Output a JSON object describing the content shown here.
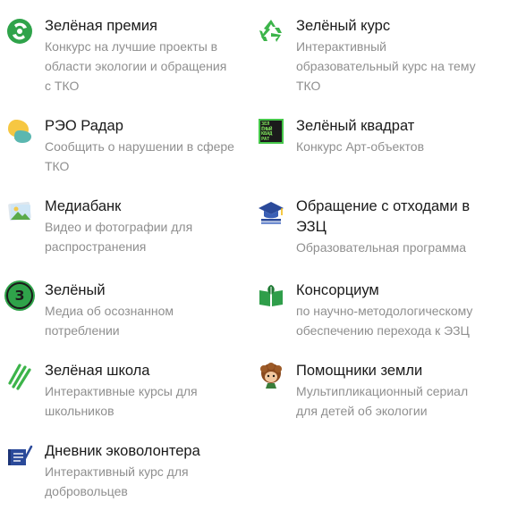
{
  "items": [
    {
      "title": "Зелёная премия",
      "desc": [
        "Конкурс на лучшие проекты в",
        "области экологии и обращения",
        "с ТКО"
      ],
      "icon": "green-award-icon"
    },
    {
      "title": "Зелёный курс",
      "desc": [
        "Интерактивный",
        "образовательный курс на тему",
        "ТКО"
      ],
      "icon": "recycle-icon"
    },
    {
      "title": "РЭО Радар",
      "desc": [
        "Сообщить о нарушении в сфере",
        "ТКО"
      ],
      "icon": "radar-chat-icon"
    },
    {
      "title": "Зелёный квадрат",
      "desc": [
        "Конкурс Арт-объектов"
      ],
      "icon": "green-square-icon",
      "badge_text": [
        "ЗЕЛ",
        "ЁНЫЙ",
        "КВАД",
        "РАТ"
      ]
    },
    {
      "title": "Медиабанк",
      "desc": [
        "Видео и фотографии для",
        "распространения"
      ],
      "icon": "media-picture-icon"
    },
    {
      "title": "Обращение с отходами в",
      "title2": "ЭЗЦ",
      "desc": [
        "Образовательная программа"
      ],
      "icon": "graduation-cap-icon"
    },
    {
      "title": "Зелёный",
      "desc": [
        "Медиа об осознанном",
        "потреблении"
      ],
      "icon": "zeleny-media-icon",
      "badge_text": [
        "З"
      ]
    },
    {
      "title": "Консорциум",
      "desc": [
        "по научно-методологическому",
        "обеспечению перехода к ЭЗЦ"
      ],
      "icon": "book-leaf-icon"
    },
    {
      "title": "Зелёная школа",
      "desc": [
        "Интерактивные курсы для",
        "школьников"
      ],
      "icon": "pencils-icon"
    },
    {
      "title": "Помощники земли",
      "desc": [
        "Мультипликационный сериал",
        "для детей об экологии"
      ],
      "icon": "cartoon-character-icon"
    },
    {
      "title": "Дневник эковолонтера",
      "desc": [
        "Интерактивный курс для",
        "добровольцев"
      ],
      "icon": "diary-pen-icon"
    }
  ],
  "colors": {
    "title": "#1a1a1a",
    "desc": "#8f8f8f",
    "accent_green": "#3cb44a",
    "radar_yellow": "#f6c742",
    "radar_teal": "#5bb7b0",
    "blue": "#2b4a9a"
  }
}
